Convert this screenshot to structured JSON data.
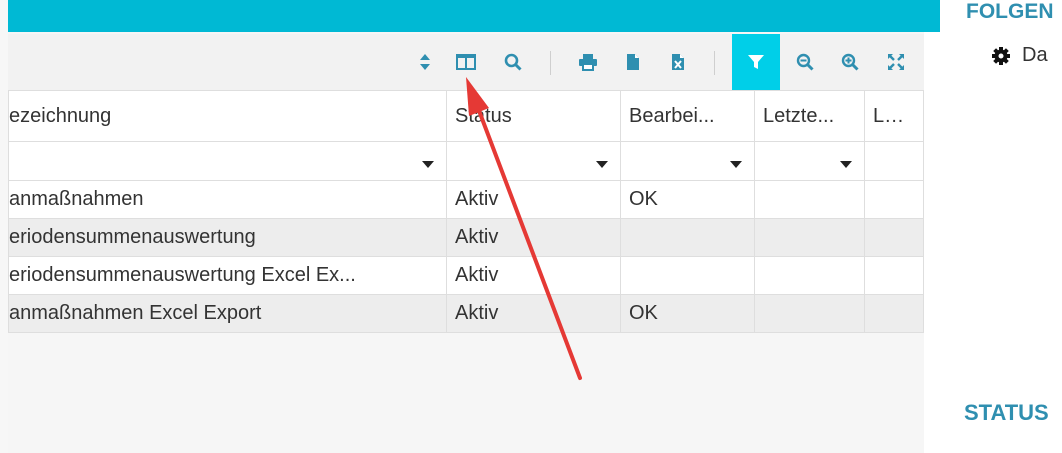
{
  "toolbar": {
    "icons": [
      "sort-icon",
      "columns-icon",
      "search-icon",
      "print-icon",
      "document-icon",
      "excel-icon",
      "filter-icon",
      "zoom-out-icon",
      "zoom-in-icon",
      "fullscreen-icon"
    ],
    "accent": "#00b9d4",
    "active_filter_color": "#00cfe8"
  },
  "grid": {
    "columns": [
      "ezeichnung",
      "Status",
      "Bearbei...",
      "Letzte...",
      "Letzt"
    ],
    "rows": [
      [
        "anmaßnahmen",
        "Aktiv",
        "OK",
        "",
        ""
      ],
      [
        "eriodensummenauswertung",
        "Aktiv",
        "",
        "",
        ""
      ],
      [
        "eriodensummenauswertung Excel Ex...",
        "Aktiv",
        "",
        "",
        ""
      ],
      [
        "anmaßnahmen Excel Export",
        "Aktiv",
        "OK",
        "",
        ""
      ]
    ]
  },
  "right_panel": {
    "title": "FOLGEN",
    "item": "Da",
    "status_title": "STATUS",
    "title_color": "#2f8fb0"
  },
  "annotation": {
    "arrow_color": "#e53935"
  }
}
